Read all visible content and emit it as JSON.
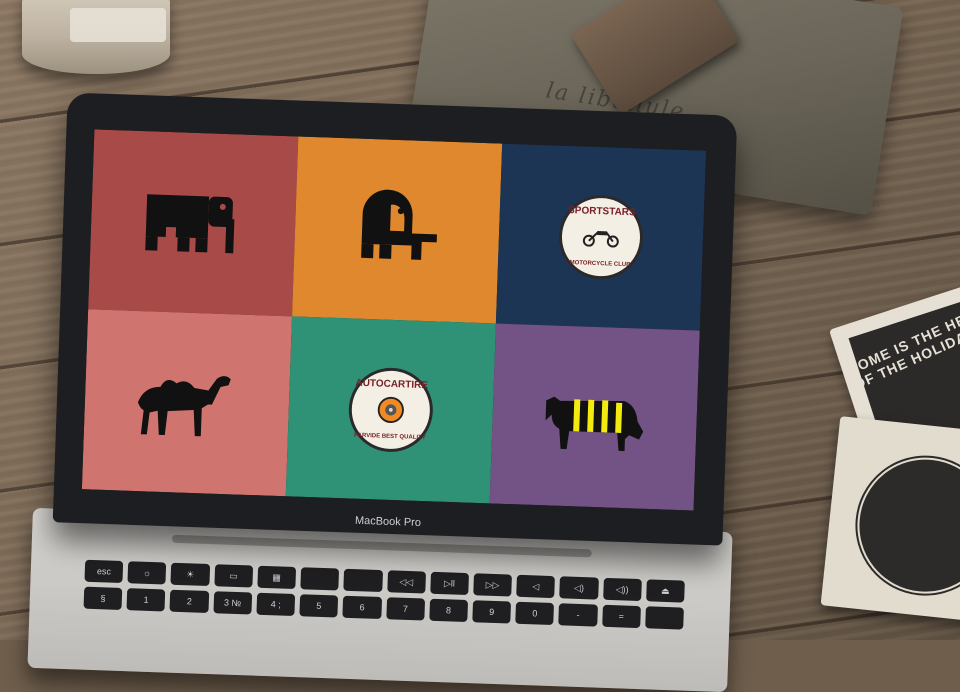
{
  "scene": {
    "pouch_text": "la libellule",
    "coaster_text": "HOME IS THE HEART OF THE HOLIDAYS"
  },
  "laptop": {
    "brand_label": "MacBook Pro"
  },
  "screen_tiles": [
    {
      "name": "elephant-block-logo",
      "bg": "#a84a48"
    },
    {
      "name": "elephant-round-logo",
      "bg": "#e0882d"
    },
    {
      "name": "sportstars-badge",
      "bg": "#1d3555",
      "badge_top": "SPORTSTARS",
      "badge_bottom": "MOTORCYCLE CLUB"
    },
    {
      "name": "camel-logo",
      "bg": "#d0746f"
    },
    {
      "name": "autocartire-badge",
      "bg": "#2f9277",
      "badge_top": "AUTOCARTIRE",
      "badge_bottom": "PARVIDE BEST QUALITY"
    },
    {
      "name": "cow-logo",
      "bg": "#735385"
    }
  ],
  "keyboard": {
    "row1": [
      "esc",
      "☼",
      "☀",
      "▭",
      "▦",
      "",
      "",
      "◁◁",
      "▷ll",
      "▷▷",
      "◁",
      "◁)",
      "◁))",
      "⏏"
    ],
    "row2": [
      "±",
      "!",
      "@",
      "#",
      "$",
      "%",
      "^",
      "&",
      "*",
      "(",
      ")",
      "_",
      "+",
      "⌫"
    ],
    "row2_sub": [
      "§",
      "1",
      "2",
      "3 №",
      "4 ;",
      "5",
      "6",
      "7",
      "8",
      "9",
      "0",
      "-",
      "=",
      ""
    ]
  }
}
